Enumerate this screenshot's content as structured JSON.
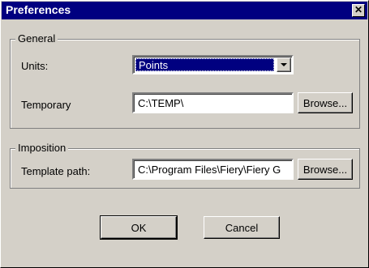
{
  "window": {
    "title": "Preferences",
    "close_label": "✕"
  },
  "general": {
    "group_label": "General",
    "units_label": "Units:",
    "units_value": "Points",
    "temporary_label": "Temporary",
    "temporary_value": "C:\\TEMP\\",
    "browse_label": "Browse..."
  },
  "imposition": {
    "group_label": "Imposition",
    "template_label": "Template path:",
    "template_value": "C:\\Program Files\\Fiery\\Fiery G",
    "browse_label": "Browse..."
  },
  "actions": {
    "ok_label": "OK",
    "cancel_label": "Cancel"
  },
  "colors": {
    "titlebar": "#000080",
    "face": "#d4d0c8",
    "selection": "#000080"
  }
}
